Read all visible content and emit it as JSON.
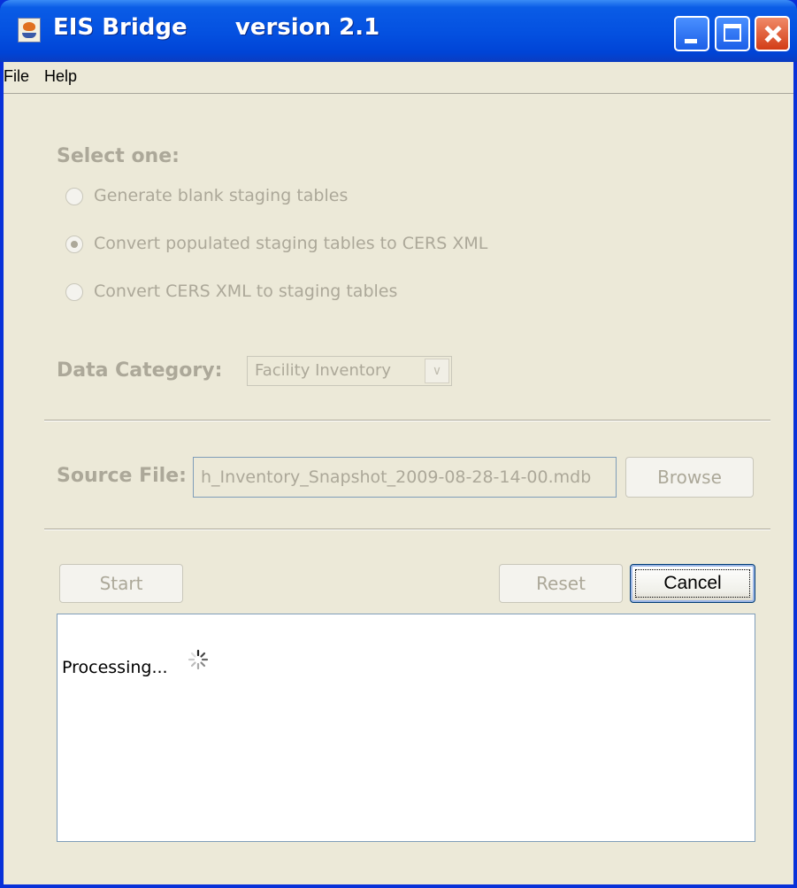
{
  "window": {
    "title": "EIS Bridge      version 2.1",
    "controls": [
      "minimize-icon",
      "maximize-icon",
      "close-icon"
    ]
  },
  "menubar": {
    "items": [
      "File",
      "Help"
    ]
  },
  "form": {
    "select_heading": "Select one:",
    "options": [
      {
        "label": "Generate blank staging tables",
        "selected": false
      },
      {
        "label": "Convert populated staging tables to CERS XML",
        "selected": true
      },
      {
        "label": "Convert CERS XML to staging tables",
        "selected": false
      }
    ],
    "data_category_label": "Data Category:",
    "data_category_value": "Facility Inventory",
    "source_file_label": "Source File:",
    "source_file_value": "h_Inventory_Snapshot_2009-08-28-14-00.mdb",
    "browse_label": "Browse"
  },
  "actions": {
    "start_label": "Start",
    "reset_label": "Reset",
    "cancel_label": "Cancel"
  },
  "output": {
    "status_text": "Processing...",
    "spinner_icon": "spinner-icon"
  },
  "colors": {
    "title_bar": "#0450e0",
    "client_bg": "#ece9d8",
    "disabled_text": "#aca899"
  }
}
